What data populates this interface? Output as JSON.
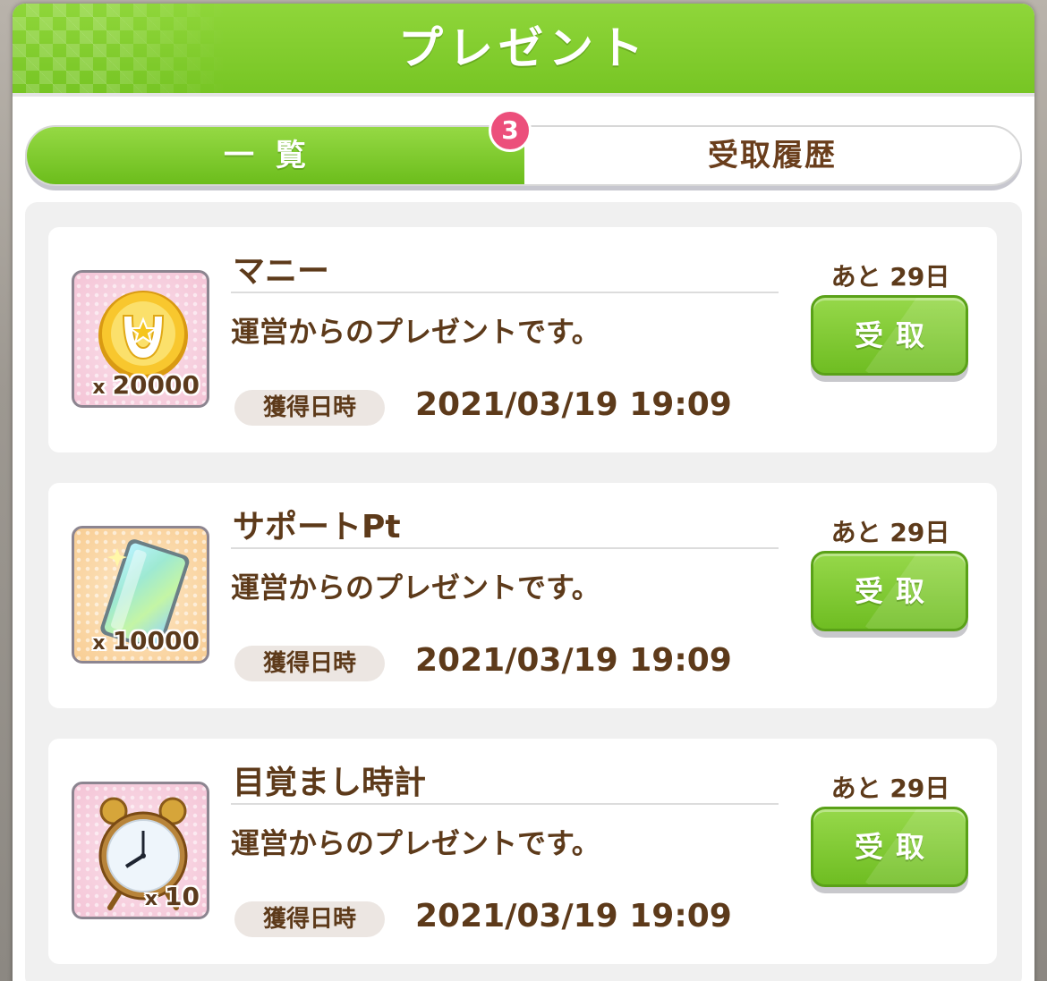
{
  "header": {
    "title": "プレゼント"
  },
  "tabs": {
    "list_label": "一覧",
    "history_label": "受取履歴",
    "badge_count": "3"
  },
  "items": [
    {
      "name": "マニー",
      "description": "運営からのプレゼントです。",
      "quantity_prefix": "x",
      "quantity": "20000",
      "date_label": "獲得日時",
      "date": "2021/03/19 19:09",
      "remaining": "あと 29日",
      "button_label": "受取",
      "icon": "horseshoe-coin-icon"
    },
    {
      "name": "サポートPt",
      "description": "運営からのプレゼントです。",
      "quantity_prefix": "x",
      "quantity": "10000",
      "date_label": "獲得日時",
      "date": "2021/03/19 19:09",
      "remaining": "あと 29日",
      "button_label": "受取",
      "icon": "support-pt-card-icon"
    },
    {
      "name": "目覚まし時計",
      "description": "運営からのプレゼントです。",
      "quantity_prefix": "x",
      "quantity": "10",
      "date_label": "獲得日時",
      "date": "2021/03/19 19:09",
      "remaining": "あと 29日",
      "button_label": "受取",
      "icon": "alarm-clock-icon"
    }
  ],
  "colors": {
    "accent_green": "#77c524",
    "badge_pink": "#ec4f7b",
    "text_brown": "#5d3a1a"
  }
}
